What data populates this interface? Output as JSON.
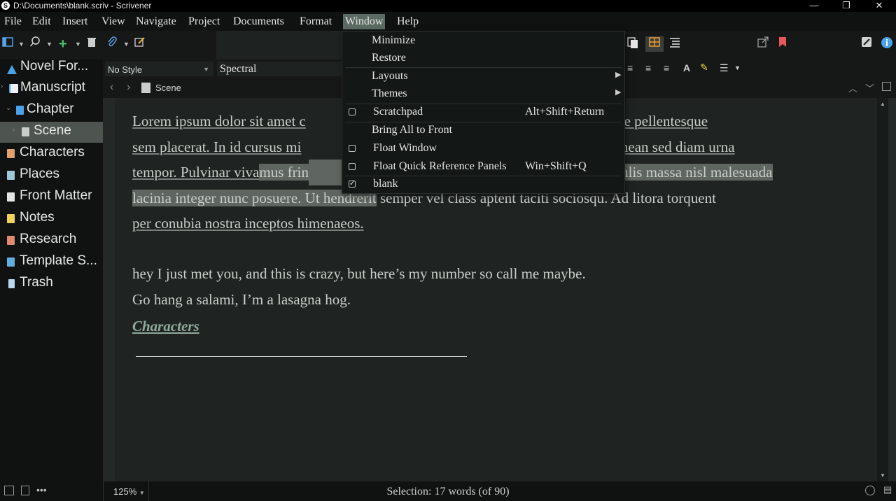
{
  "window": {
    "title": "D:\\Documents\\blank.scriv - Scrivener",
    "app_icon": "S",
    "controls": {
      "minimize": "—",
      "restore": "❐",
      "close": "✕"
    }
  },
  "menubar": [
    {
      "label": "File"
    },
    {
      "label": "Edit"
    },
    {
      "label": "Insert"
    },
    {
      "label": "View"
    },
    {
      "label": "Navigate"
    },
    {
      "label": "Project"
    },
    {
      "label": "Documents"
    },
    {
      "label": "Format"
    },
    {
      "label": "Window"
    },
    {
      "label": "Help"
    }
  ],
  "binder": {
    "items": [
      {
        "label": "Novel For...",
        "icon": "novel-format-icon"
      },
      {
        "label": "Manuscript",
        "icon": "manuscript-icon"
      },
      {
        "label": "Chapter",
        "icon": "chapter-icon"
      },
      {
        "label": "Scene",
        "icon": "scene-icon"
      },
      {
        "label": "Characters",
        "icon": "characters-icon"
      },
      {
        "label": "Places",
        "icon": "places-icon"
      },
      {
        "label": "Front Matter",
        "icon": "front-matter-icon"
      },
      {
        "label": "Notes",
        "icon": "notes-icon"
      },
      {
        "label": "Research",
        "icon": "research-icon"
      },
      {
        "label": "Template S...",
        "icon": "template-sheets-icon"
      },
      {
        "label": "Trash",
        "icon": "trash-icon"
      }
    ]
  },
  "formatbar": {
    "style": "No Style",
    "font": "Spectral"
  },
  "editor": {
    "document_title": "Scene",
    "lorem_a": "Lorem ipsum dolor sit amet c",
    "lorem_b": "ibus ex sapien vitae pellentesque",
    "lorem_c": "sem placerat. In id cursus mi",
    "lorem_d": "o eu aenean sed diam urna",
    "lorem_e": "tempor. Pulvinar viva",
    "lorem_f": "mus frin",
    "lorem_g": ". Iaculis massa nisl malesuada",
    "lorem_h": "lacinia integer nunc posuere. Ut hendrerit",
    "lorem_i": " semper vel class aptent taciti sociosqu. Ad litora torquent",
    "lorem_j": "per conubia nostra inceptos himenaeos.",
    "line1": "hey I just met you, and this is crazy, but here’s my number so call me maybe.",
    "line2": "Go hang a salami, I’m a lasagna hog.",
    "link": "Characters"
  },
  "footer": {
    "zoom": "125%",
    "status": "Selection: 17 words (of 90)"
  },
  "window_menu": {
    "minimize": "Minimize",
    "restore": "Restore",
    "layouts": "Layouts",
    "themes": "Themes",
    "scratchpad": "Scratchpad",
    "scratchpad_shortcut": "Alt+Shift+Return",
    "bring_all": "Bring All to Front",
    "float_window": "Float Window",
    "float_quick": "Float Quick Reference Panels",
    "float_quick_shortcut": "Win+Shift+Q",
    "blank": "blank"
  },
  "colors": {
    "accent_menu": "#5b6b63",
    "selection": "#4e5450",
    "highlight": "#5f6561",
    "bookmark": "#e8575a",
    "link": "#8fa99b"
  }
}
